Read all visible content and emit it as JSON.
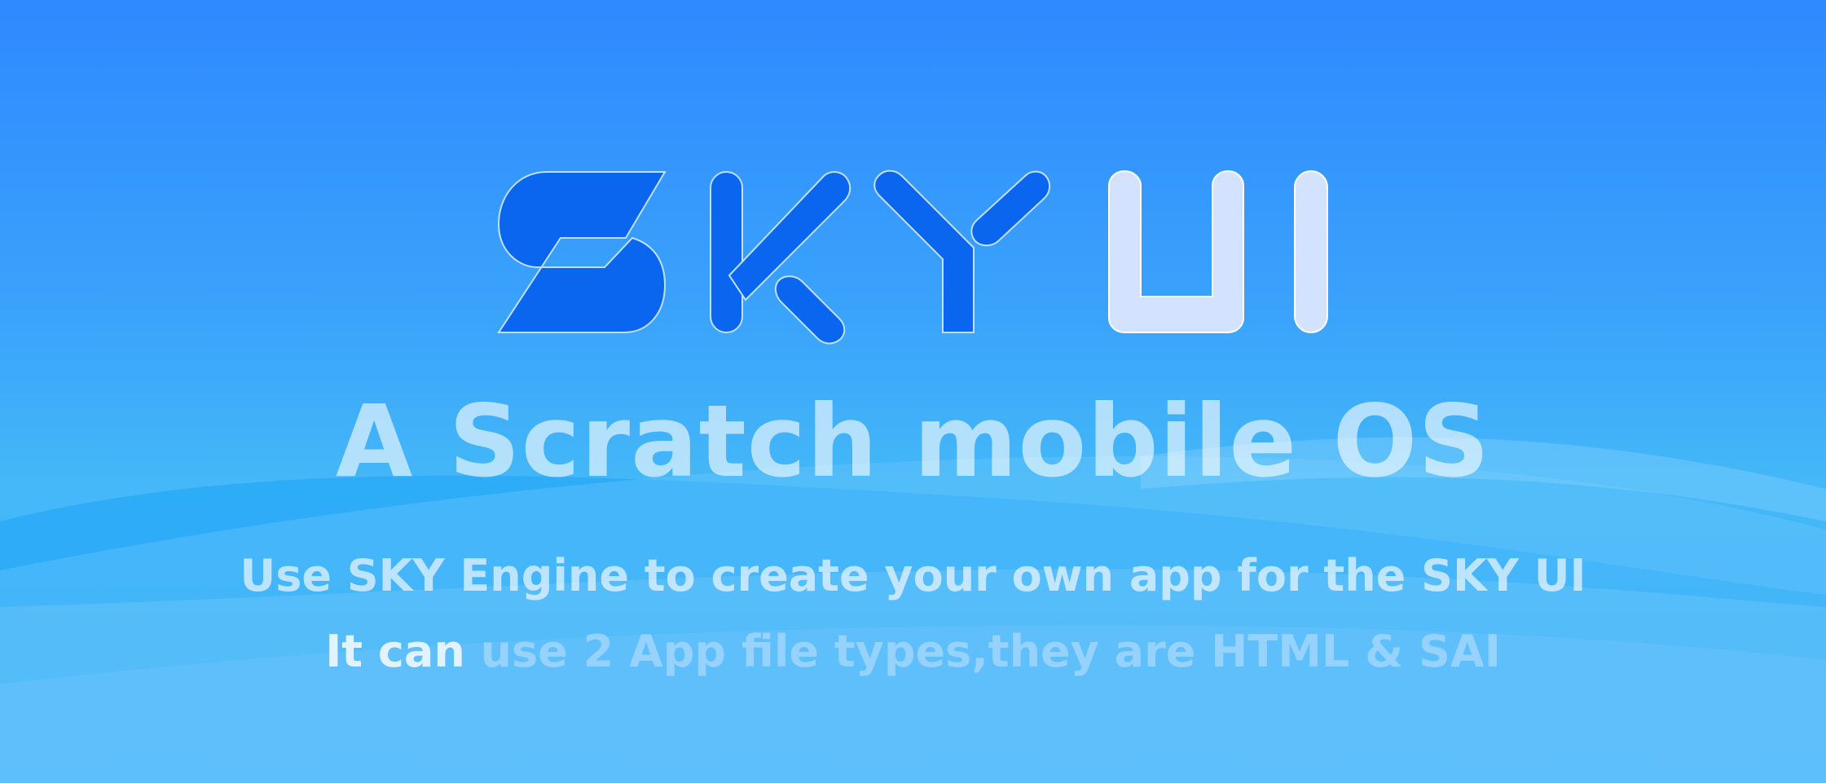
{
  "logo": {
    "text": "SKY UI",
    "colors": {
      "sky_letters": "#0a66ef",
      "ui_letters": "#d3e3ff",
      "outline": "#bfe0ff"
    }
  },
  "headline": "A Scratch mobile OS",
  "description": {
    "line1": "Use SKY Engine to create your own app for the SKY UI",
    "line2_lead": "It can ",
    "line2_rest": "use 2 App file types,they are HTML & SAI"
  },
  "colors": {
    "background_top": "#2f89ff",
    "background_bottom": "#44b8f8"
  }
}
